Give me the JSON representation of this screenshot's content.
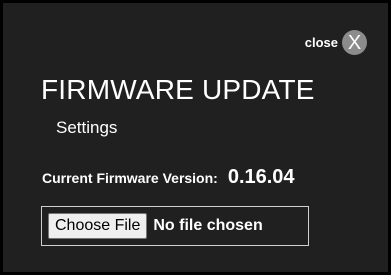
{
  "dialog": {
    "close_label": "close",
    "close_glyph": "X",
    "title": "FIRMWARE UPDATE",
    "subtitle": "Settings",
    "firmware_label": "Current Firmware Version:",
    "firmware_version": "0.16.04",
    "file_input": {
      "button_label": "Choose File",
      "status": "No file chosen"
    }
  },
  "colors": {
    "panel_background": "#202020",
    "panel_border": "#000000",
    "text": "#ffffff",
    "close_circle": "#8c8c8c",
    "file_box_border": "#cfcfcf",
    "button_background": "#efefef"
  },
  "icons": {
    "close": "close-icon"
  }
}
